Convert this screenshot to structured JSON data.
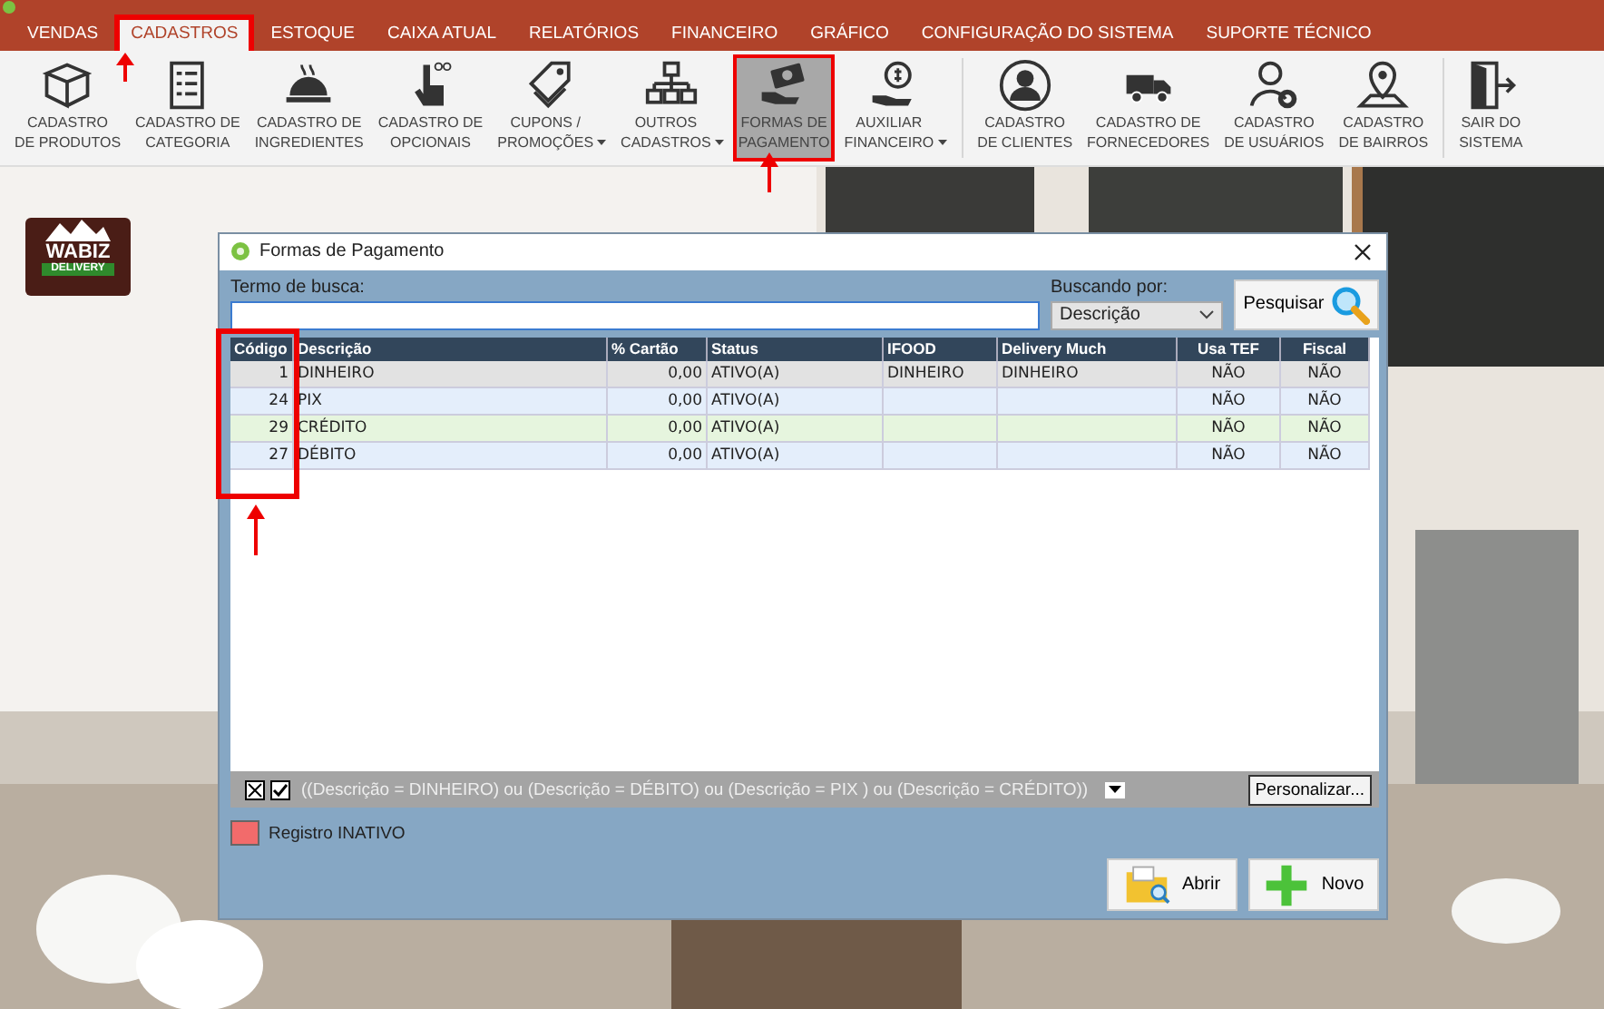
{
  "menu_tabs": [
    {
      "label": "VENDAS",
      "selected": false
    },
    {
      "label": "CADASTROS",
      "selected": true
    },
    {
      "label": "ESTOQUE",
      "selected": false
    },
    {
      "label": "CAIXA ATUAL",
      "selected": false
    },
    {
      "label": "RELATÓRIOS",
      "selected": false
    },
    {
      "label": "FINANCEIRO",
      "selected": false
    },
    {
      "label": "GRÁFICO",
      "selected": false
    },
    {
      "label": "CONFIGURAÇÃO DO SISTEMA",
      "selected": false
    },
    {
      "label": "SUPORTE TÉCNICO",
      "selected": false
    }
  ],
  "ribbon": {
    "groups": [
      [
        {
          "label": "CADASTRO\nDE PRODUTOS",
          "dropdown": false,
          "selected": false
        },
        {
          "label": "CADASTRO DE\nCATEGORIA",
          "dropdown": false,
          "selected": false
        },
        {
          "label": "CADASTRO DE\nINGREDIENTES",
          "dropdown": false,
          "selected": false
        },
        {
          "label": "CADASTRO DE\nOPCIONAIS",
          "dropdown": false,
          "selected": false
        },
        {
          "label": "CUPONS /\nPROMOÇÕES",
          "dropdown": true,
          "selected": false
        },
        {
          "label": "OUTROS\nCADASTROS",
          "dropdown": true,
          "selected": false
        },
        {
          "label": "FORMAS DE\nPAGAMENTO",
          "dropdown": false,
          "selected": true
        },
        {
          "label": "AUXILIAR\nFINANCEIRO",
          "dropdown": true,
          "selected": false
        }
      ],
      [
        {
          "label": "CADASTRO\nDE CLIENTES",
          "dropdown": false,
          "selected": false
        },
        {
          "label": "CADASTRO DE\nFORNECEDORES",
          "dropdown": false,
          "selected": false
        },
        {
          "label": "CADASTRO\nDE USUÁRIOS",
          "dropdown": false,
          "selected": false
        },
        {
          "label": "CADASTRO\nDE BAIRROS",
          "dropdown": false,
          "selected": false
        }
      ],
      [
        {
          "label": "SAIR DO\nSISTEMA",
          "dropdown": false,
          "selected": false
        }
      ]
    ]
  },
  "logo": {
    "name": "WABIZ",
    "tagline": "DELIVERY"
  },
  "dialog": {
    "title": "Formas de Pagamento",
    "search_label": "Termo de busca:",
    "search_by_label": "Buscando por:",
    "search_by_value": "Descrição",
    "search_button": "Pesquisar",
    "columns": [
      "Código",
      "Descrição",
      "% Cartão",
      "Status",
      "IFOOD",
      "Delivery Much",
      "Usa TEF",
      "Fiscal"
    ],
    "rows": [
      {
        "selected": true,
        "cells": [
          "1",
          "DINHEIRO",
          "0,00",
          "ATIVO(A)",
          "DINHEIRO",
          "DINHEIRO",
          "NÃO",
          "NÃO"
        ]
      },
      {
        "selected": false,
        "cells": [
          "24",
          "PIX",
          "0,00",
          "ATIVO(A)",
          "",
          "",
          "NÃO",
          "NÃO"
        ]
      },
      {
        "selected": false,
        "cells": [
          "29",
          "CRÉDITO",
          "0,00",
          "ATIVO(A)",
          "",
          "",
          "NÃO",
          "NÃO"
        ]
      },
      {
        "selected": false,
        "cells": [
          "27",
          "DÉBITO",
          "0,00",
          "ATIVO(A)",
          "",
          "",
          "NÃO",
          "NÃO"
        ]
      }
    ],
    "filter": {
      "enabled": true,
      "text": "((Descrição = DINHEIRO) ou (Descrição = DÉBITO) ou (Descrição = PIX ) ou (Descrição = CRÉDITO))",
      "customize_button": "Personalizar..."
    },
    "legend": {
      "label": "Registro INATIVO",
      "color": "#f26b6b"
    },
    "buttons": [
      {
        "label": "Abrir",
        "kind": "open"
      },
      {
        "label": "Novo",
        "kind": "new"
      }
    ]
  }
}
